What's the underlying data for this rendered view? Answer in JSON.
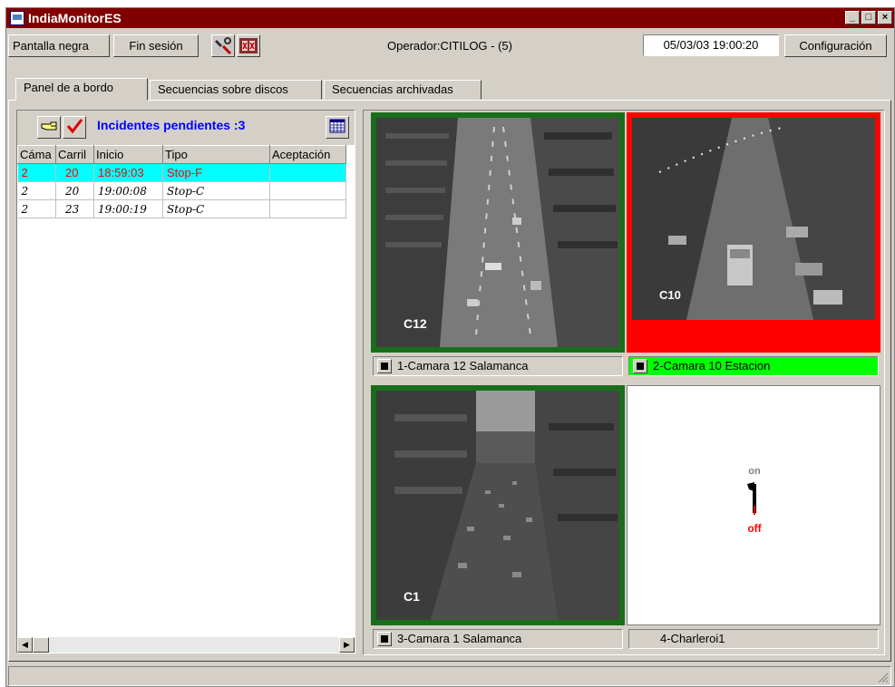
{
  "window": {
    "title": "IndiaMonitorES"
  },
  "toolbar": {
    "black_screen": "Pantalla negra",
    "logout": "Fin sesión",
    "operator": "Operador:CITILOG - (5)",
    "datetime": "05/03/03 19:00:20",
    "config": "Configuración"
  },
  "tabs": [
    {
      "label": "Panel de a bordo",
      "active": true
    },
    {
      "label": "Secuencias sobre discos",
      "active": false
    },
    {
      "label": "Secuencias archivadas",
      "active": false
    }
  ],
  "incidents": {
    "title": "Incidentes pendientes :3",
    "columns": [
      "Cáma",
      "Carril",
      "Inicio",
      "Tipo",
      "Aceptación"
    ],
    "rows": [
      {
        "cam": "2",
        "lane": "20",
        "start": "18:59:03",
        "type": "Stop-F",
        "accept": "",
        "selected": true
      },
      {
        "cam": "2",
        "lane": "20",
        "start": "19:00:08",
        "type": "Stop-C",
        "accept": "",
        "selected": false
      },
      {
        "cam": "2",
        "lane": "23",
        "start": "19:00:19",
        "type": "Stop-C",
        "accept": "",
        "selected": false
      }
    ]
  },
  "cameras": [
    {
      "label": "1-Camara 12 Salamanca",
      "overlay": "C12",
      "state": "normal"
    },
    {
      "label": "2-Camara 10 Estacion",
      "overlay": "C10",
      "state": "alarm"
    },
    {
      "label": "3-Camara 1 Salamanca",
      "overlay": "C1",
      "state": "normal"
    },
    {
      "label": "4-Charleroi1",
      "state": "off"
    }
  ],
  "switch": {
    "on": "on",
    "off": "off"
  },
  "colors": {
    "titlebar": "#800000",
    "selected_row": "#00ffff",
    "alarm": "#ff0000",
    "ok_label": "#00ff00",
    "cam_border": "#1a6e1a"
  }
}
